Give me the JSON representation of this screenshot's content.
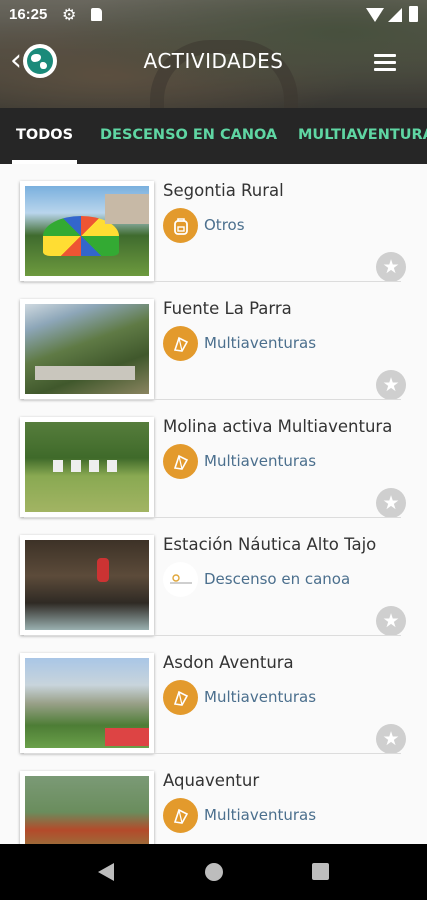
{
  "status_bar": {
    "time": "16:25"
  },
  "header": {
    "title": "ACTIVIDADES"
  },
  "tabs": [
    {
      "label": "TODOS",
      "active": true
    },
    {
      "label": "DESCENSO EN CANOA",
      "active": false
    },
    {
      "label": "MULTIAVENTURA",
      "active": false
    }
  ],
  "colors": {
    "tab_active": "#ffffff",
    "tab_inactive": "#5fd6a3",
    "category_icon": "#e39a2c",
    "category_text": "#4b6f8d",
    "tabs_bg": "#262626"
  },
  "items": [
    {
      "name": "Segontia Rural",
      "category": "Otros",
      "category_icon": "backpack-icon"
    },
    {
      "name": "Fuente La Parra",
      "category": "Multiaventuras",
      "category_icon": "climbing-icon"
    },
    {
      "name": "Molina activa Multiaventura",
      "category": "Multiaventuras",
      "category_icon": "climbing-icon"
    },
    {
      "name": "Estación Náutica Alto Tajo",
      "category": "Descenso en canoa",
      "category_icon": "canoe-logo-icon"
    },
    {
      "name": "Asdon Aventura",
      "category": "Multiaventuras",
      "category_icon": "climbing-icon"
    },
    {
      "name": "Aquaventur",
      "category": "Multiaventuras",
      "category_icon": "climbing-icon"
    }
  ]
}
